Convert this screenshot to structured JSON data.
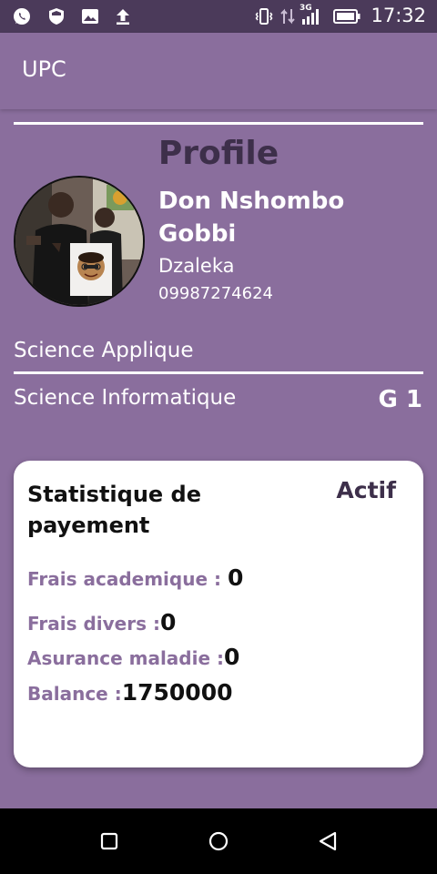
{
  "status_bar": {
    "time": "17:32",
    "network_label": "3G",
    "icons": [
      "whatsapp-icon",
      "shield-icon",
      "image-icon",
      "upload-icon",
      "vibrate-icon",
      "data-arrows-icon",
      "signal-icon",
      "battery-icon"
    ]
  },
  "app_bar": {
    "title": "UPC"
  },
  "profile": {
    "heading": "Profile",
    "name": "Don Nshombo Gobbi",
    "location": "Dzaleka",
    "phone": "09987274624",
    "faculty": "Science Applique",
    "department": "Science Informatique",
    "group": "G 1"
  },
  "payment_stats": {
    "title": "Statistique de payement",
    "status": "Actif",
    "rows": [
      {
        "label": "Frais academique : ",
        "value": "0"
      },
      {
        "label": "Frais divers :",
        "value": "0"
      },
      {
        "label": "Asurance maladie :",
        "value": "0"
      },
      {
        "label": "Balance :",
        "value": "1750000"
      }
    ]
  },
  "nav_bar": {
    "buttons": [
      "recents-icon",
      "home-icon",
      "back-icon"
    ]
  },
  "colors": {
    "primary": "#8a6e9d",
    "status_bar": "#4b3a5a",
    "heading": "#3d2f4a"
  }
}
